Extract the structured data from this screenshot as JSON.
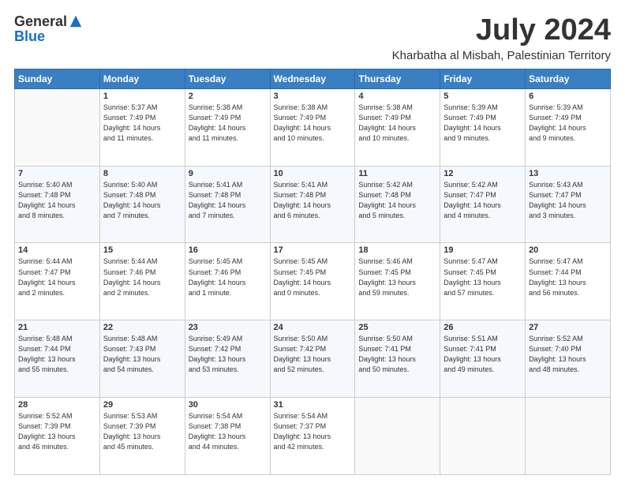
{
  "header": {
    "logo_general": "General",
    "logo_blue": "Blue",
    "month": "July 2024",
    "location": "Kharbatha al Misbah, Palestinian Territory"
  },
  "days_of_week": [
    "Sunday",
    "Monday",
    "Tuesday",
    "Wednesday",
    "Thursday",
    "Friday",
    "Saturday"
  ],
  "weeks": [
    [
      {
        "day": "",
        "info": ""
      },
      {
        "day": "1",
        "info": "Sunrise: 5:37 AM\nSunset: 7:49 PM\nDaylight: 14 hours\nand 11 minutes."
      },
      {
        "day": "2",
        "info": "Sunrise: 5:38 AM\nSunset: 7:49 PM\nDaylight: 14 hours\nand 11 minutes."
      },
      {
        "day": "3",
        "info": "Sunrise: 5:38 AM\nSunset: 7:49 PM\nDaylight: 14 hours\nand 10 minutes."
      },
      {
        "day": "4",
        "info": "Sunrise: 5:38 AM\nSunset: 7:49 PM\nDaylight: 14 hours\nand 10 minutes."
      },
      {
        "day": "5",
        "info": "Sunrise: 5:39 AM\nSunset: 7:49 PM\nDaylight: 14 hours\nand 9 minutes."
      },
      {
        "day": "6",
        "info": "Sunrise: 5:39 AM\nSunset: 7:49 PM\nDaylight: 14 hours\nand 9 minutes."
      }
    ],
    [
      {
        "day": "7",
        "info": "Sunrise: 5:40 AM\nSunset: 7:48 PM\nDaylight: 14 hours\nand 8 minutes."
      },
      {
        "day": "8",
        "info": "Sunrise: 5:40 AM\nSunset: 7:48 PM\nDaylight: 14 hours\nand 7 minutes."
      },
      {
        "day": "9",
        "info": "Sunrise: 5:41 AM\nSunset: 7:48 PM\nDaylight: 14 hours\nand 7 minutes."
      },
      {
        "day": "10",
        "info": "Sunrise: 5:41 AM\nSunset: 7:48 PM\nDaylight: 14 hours\nand 6 minutes."
      },
      {
        "day": "11",
        "info": "Sunrise: 5:42 AM\nSunset: 7:48 PM\nDaylight: 14 hours\nand 5 minutes."
      },
      {
        "day": "12",
        "info": "Sunrise: 5:42 AM\nSunset: 7:47 PM\nDaylight: 14 hours\nand 4 minutes."
      },
      {
        "day": "13",
        "info": "Sunrise: 5:43 AM\nSunset: 7:47 PM\nDaylight: 14 hours\nand 3 minutes."
      }
    ],
    [
      {
        "day": "14",
        "info": "Sunrise: 5:44 AM\nSunset: 7:47 PM\nDaylight: 14 hours\nand 2 minutes."
      },
      {
        "day": "15",
        "info": "Sunrise: 5:44 AM\nSunset: 7:46 PM\nDaylight: 14 hours\nand 2 minutes."
      },
      {
        "day": "16",
        "info": "Sunrise: 5:45 AM\nSunset: 7:46 PM\nDaylight: 14 hours\nand 1 minute."
      },
      {
        "day": "17",
        "info": "Sunrise: 5:45 AM\nSunset: 7:45 PM\nDaylight: 14 hours\nand 0 minutes."
      },
      {
        "day": "18",
        "info": "Sunrise: 5:46 AM\nSunset: 7:45 PM\nDaylight: 13 hours\nand 59 minutes."
      },
      {
        "day": "19",
        "info": "Sunrise: 5:47 AM\nSunset: 7:45 PM\nDaylight: 13 hours\nand 57 minutes."
      },
      {
        "day": "20",
        "info": "Sunrise: 5:47 AM\nSunset: 7:44 PM\nDaylight: 13 hours\nand 56 minutes."
      }
    ],
    [
      {
        "day": "21",
        "info": "Sunrise: 5:48 AM\nSunset: 7:44 PM\nDaylight: 13 hours\nand 55 minutes."
      },
      {
        "day": "22",
        "info": "Sunrise: 5:48 AM\nSunset: 7:43 PM\nDaylight: 13 hours\nand 54 minutes."
      },
      {
        "day": "23",
        "info": "Sunrise: 5:49 AM\nSunset: 7:42 PM\nDaylight: 13 hours\nand 53 minutes."
      },
      {
        "day": "24",
        "info": "Sunrise: 5:50 AM\nSunset: 7:42 PM\nDaylight: 13 hours\nand 52 minutes."
      },
      {
        "day": "25",
        "info": "Sunrise: 5:50 AM\nSunset: 7:41 PM\nDaylight: 13 hours\nand 50 minutes."
      },
      {
        "day": "26",
        "info": "Sunrise: 5:51 AM\nSunset: 7:41 PM\nDaylight: 13 hours\nand 49 minutes."
      },
      {
        "day": "27",
        "info": "Sunrise: 5:52 AM\nSunset: 7:40 PM\nDaylight: 13 hours\nand 48 minutes."
      }
    ],
    [
      {
        "day": "28",
        "info": "Sunrise: 5:52 AM\nSunset: 7:39 PM\nDaylight: 13 hours\nand 46 minutes."
      },
      {
        "day": "29",
        "info": "Sunrise: 5:53 AM\nSunset: 7:39 PM\nDaylight: 13 hours\nand 45 minutes."
      },
      {
        "day": "30",
        "info": "Sunrise: 5:54 AM\nSunset: 7:38 PM\nDaylight: 13 hours\nand 44 minutes."
      },
      {
        "day": "31",
        "info": "Sunrise: 5:54 AM\nSunset: 7:37 PM\nDaylight: 13 hours\nand 42 minutes."
      },
      {
        "day": "",
        "info": ""
      },
      {
        "day": "",
        "info": ""
      },
      {
        "day": "",
        "info": ""
      }
    ]
  ]
}
